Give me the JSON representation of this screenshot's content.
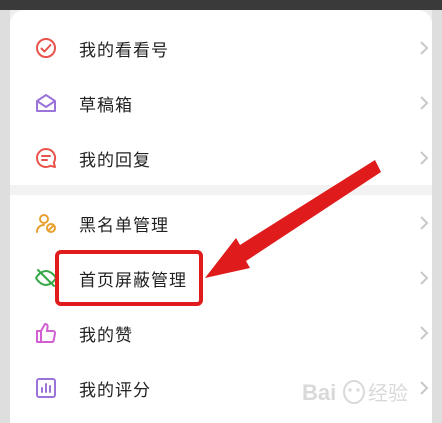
{
  "menu": {
    "items": [
      {
        "label": "我的看看号",
        "icon": "check-circle-icon",
        "color": "#e8534b"
      },
      {
        "label": "草稿箱",
        "icon": "envelope-open-icon",
        "color": "#9b74d9"
      },
      {
        "label": "我的回复",
        "icon": "chat-bubble-icon",
        "color": "#e8534b"
      },
      {
        "label": "黑名单管理",
        "icon": "user-block-icon",
        "color": "#e8a030"
      },
      {
        "label": "首页屏蔽管理",
        "icon": "eye-off-icon",
        "color": "#35a845"
      },
      {
        "label": "我的赞",
        "icon": "thumbs-up-icon",
        "color": "#d15fd1"
      },
      {
        "label": "我的评分",
        "icon": "bar-chart-icon",
        "color": "#9b74d9"
      }
    ]
  },
  "annotation": {
    "highlight_color": "#e01b1b"
  },
  "watermark": {
    "text": "Bai 经验",
    "logo_label": "du"
  }
}
